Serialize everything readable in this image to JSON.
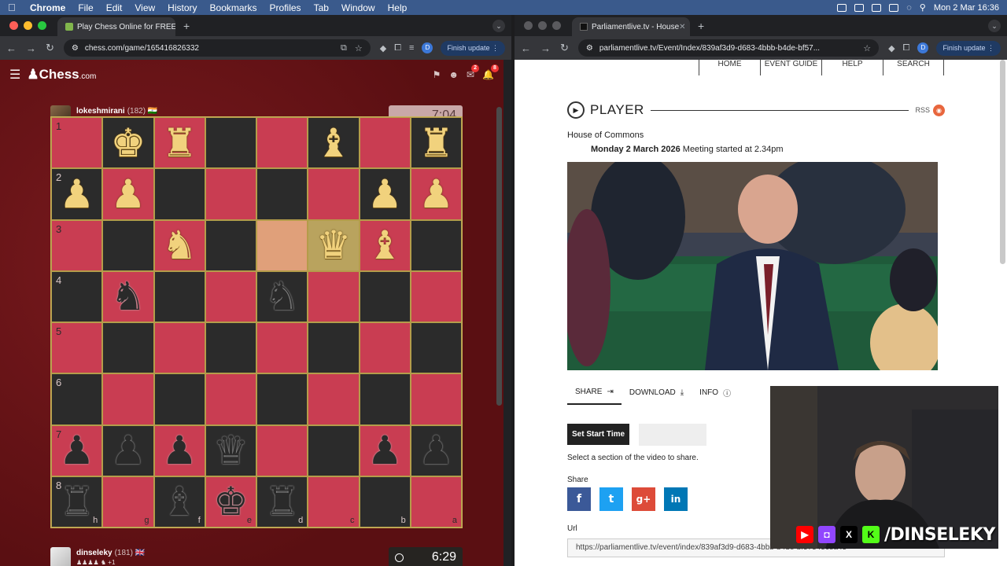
{
  "menubar": {
    "app": "Chrome",
    "items": [
      "File",
      "Edit",
      "View",
      "History",
      "Bookmarks",
      "Profiles",
      "Tab",
      "Window",
      "Help"
    ],
    "clock": "Mon 2 Mar 16:36"
  },
  "left_window": {
    "tab_title": "Play Chess Online for FREE",
    "url": "chess.com/game/165416826332",
    "finish_update": "Finish update",
    "profile_initial": "D"
  },
  "right_window": {
    "tab_title": "Parliamentlive.tv - House",
    "url": "parliamentlive.tv/Event/Index/839af3d9-d683-4bbb-b4de-bf57...",
    "finish_update": "Finish update",
    "profile_initial": "D"
  },
  "chess": {
    "logo": "Chess",
    "logo_suffix": ".com",
    "notif_counts": [
      "2",
      "8"
    ],
    "top_player": {
      "name": "lokeshmirani",
      "rating": "(182)",
      "captured": "♟♟♟ ♝",
      "clock": "7:04"
    },
    "bottom_player": {
      "name": "dinseleky",
      "rating": "(181)",
      "captured": "♟♟♟♟ ♞ +1",
      "clock": "6:29"
    },
    "ranks": [
      "1",
      "2",
      "3",
      "4",
      "5",
      "6",
      "7",
      "8"
    ],
    "files": [
      "h",
      "g",
      "f",
      "e",
      "d",
      "c",
      "b",
      "a"
    ],
    "board": [
      [
        "",
        "K",
        "R",
        "",
        "",
        "B",
        "",
        "R"
      ],
      [
        "P",
        "P",
        "",
        "",
        "",
        "",
        "P",
        "P"
      ],
      [
        "",
        "",
        "N",
        "",
        "",
        "Q",
        "B",
        ""
      ],
      [
        "",
        "n",
        "",
        "",
        "n",
        "",
        "",
        ""
      ],
      [
        "",
        "",
        "",
        "",
        "",
        "",
        "",
        ""
      ],
      [
        "",
        "",
        "",
        "",
        "",
        "",
        "",
        ""
      ],
      [
        "p",
        "p",
        "p",
        "q",
        "",
        "",
        "p",
        "p"
      ],
      [
        "r",
        "",
        "b",
        "k",
        "r",
        "",
        "",
        ""
      ]
    ]
  },
  "parliament": {
    "nav": [
      "HOME",
      "EVENT GUIDE",
      "HELP",
      "SEARCH"
    ],
    "player_heading": "PLAYER",
    "rss": "RSS",
    "house": "House of Commons",
    "date": "Monday 2 March 2026",
    "meeting": "Meeting started at 2.34pm",
    "tabs": [
      "SHARE",
      "DOWNLOAD",
      "INFO"
    ],
    "set_start": "Set Start Time",
    "select_note": "Select a section of the video to share.",
    "share_label": "Share",
    "social": [
      "f",
      "t",
      "g+",
      "in"
    ],
    "url_label": "Url",
    "share_url": "https://parliamentlive.tv/event/index/839af3d9-d683-4bbb-b4de-bf57545c8a45"
  },
  "stream": {
    "handle": "/DINSELEKY",
    "platforms": [
      "youtube-icon",
      "twitch-icon",
      "x-icon",
      "kick-icon"
    ]
  }
}
